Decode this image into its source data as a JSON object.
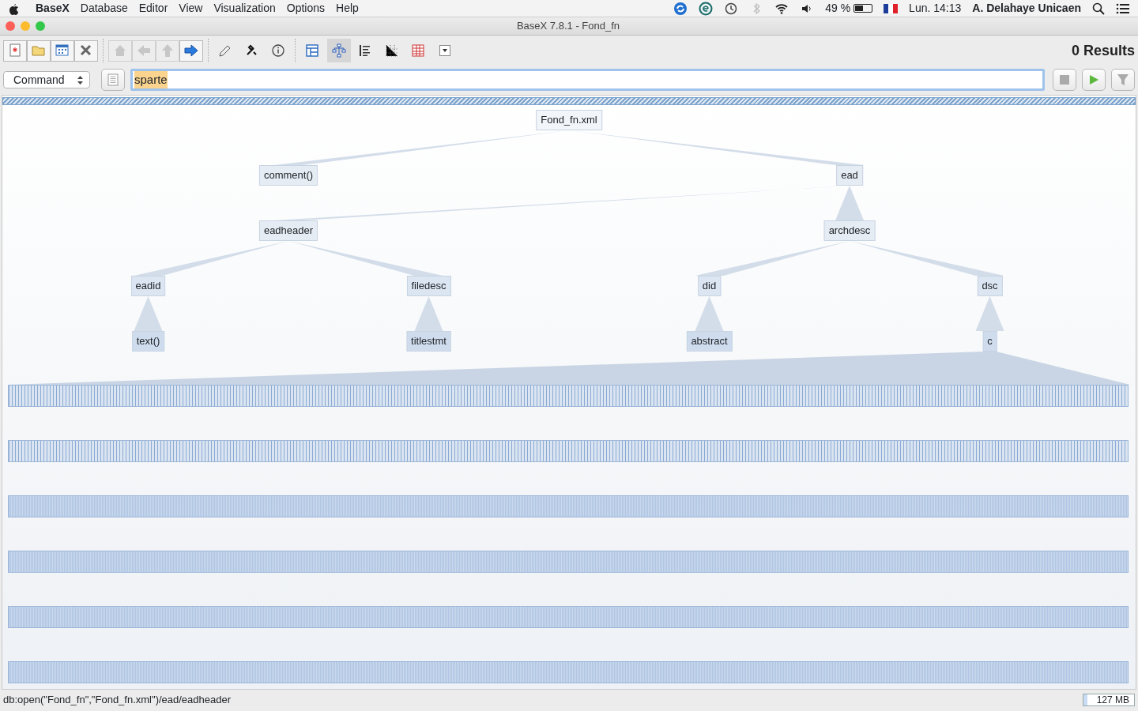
{
  "menubar": {
    "app": "BaseX",
    "menus": [
      "Database",
      "Editor",
      "View",
      "Visualization",
      "Options",
      "Help"
    ],
    "status_icons": [
      {
        "kind": "swirl"
      },
      {
        "kind": "circle-letter"
      },
      {
        "kind": "clock"
      },
      {
        "kind": "bluetooth"
      },
      {
        "kind": "wifi"
      },
      {
        "kind": "speaker"
      }
    ],
    "battery": {
      "reading": "49 %",
      "level": 0.49
    },
    "clock": "Lun. 14:13",
    "user": "A. Delahaye Unicaen"
  },
  "window": {
    "title": "BaseX 7.8.1 - Fond_fn"
  },
  "toolbar": {
    "file_buttons": [
      {
        "kind": "new"
      },
      {
        "kind": "open"
      },
      {
        "kind": "properties"
      },
      {
        "kind": "close"
      }
    ],
    "nav_buttons": [
      {
        "kind": "home",
        "disabled": true
      },
      {
        "kind": "back",
        "disabled": true
      },
      {
        "kind": "up",
        "disabled": true
      },
      {
        "kind": "forward",
        "disabled": false
      }
    ],
    "tool_buttons": [
      {
        "kind": "edit"
      },
      {
        "kind": "tools"
      },
      {
        "kind": "info"
      }
    ],
    "view_buttons": [
      {
        "kind": "map",
        "selected": false
      },
      {
        "kind": "tree",
        "selected": true
      },
      {
        "kind": "folder",
        "selected": false
      },
      {
        "kind": "plot",
        "selected": false
      },
      {
        "kind": "table",
        "selected": false
      }
    ],
    "results": "0 Results"
  },
  "query": {
    "mode": "Command",
    "value": "sparte"
  },
  "tree": {
    "label": "Fond_fn.xml",
    "children": [
      {
        "label": "comment()"
      },
      {
        "label": "ead",
        "children": [
          {
            "label": "eadheader",
            "children": [
              {
                "label": "eadid",
                "children": [
                  {
                    "label": "text()"
                  }
                ]
              },
              {
                "label": "filedesc",
                "children": [
                  {
                    "label": "titlestmt"
                  }
                ]
              }
            ]
          },
          {
            "label": "archdesc",
            "children": [
              {
                "label": "did",
                "children": [
                  {
                    "label": "abstract"
                  }
                ]
              },
              {
                "label": "dsc",
                "children": [
                  {
                    "label": "c"
                  }
                ]
              }
            ]
          }
        ]
      }
    ]
  },
  "status_bar": {
    "text": "db:open(\"Fond_fn\",\"Fond_fn.xml\")/ead/eadheader",
    "memory": "127 MB"
  }
}
